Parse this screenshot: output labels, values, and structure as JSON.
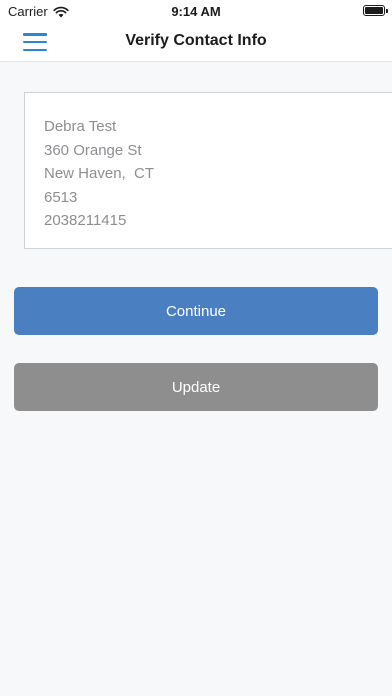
{
  "status_bar": {
    "carrier": "Carrier",
    "time": "9:14 AM",
    "icons": [
      "wifi-icon",
      "battery-icon"
    ]
  },
  "header": {
    "title": "Verify Contact Info",
    "menu_icon": "hamburger-menu-icon"
  },
  "contact": {
    "name": "Debra Test",
    "street": "360 Orange St",
    "city_state": "New Haven,  CT",
    "zip": "6513",
    "phone": "2038211415"
  },
  "actions": {
    "continue_label": "Continue",
    "update_label": "Update"
  },
  "colors": {
    "accent": "#2b86d6",
    "continue_button": "#4a7fc1",
    "update_button": "#8e8e8e",
    "background": "#f7f8fa"
  }
}
